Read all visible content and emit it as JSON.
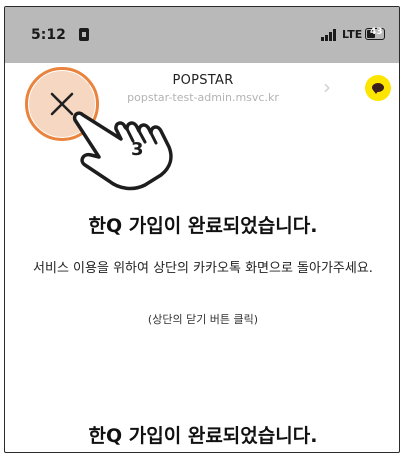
{
  "status_bar": {
    "time": "5:12",
    "network": "LTE",
    "battery": "43",
    "battery_fraction": 0.43
  },
  "browser": {
    "title": "POPSTAR",
    "url": "popstar-test-admin.msvc.kr"
  },
  "page": {
    "heading": "한Q 가입이 완료되었습니다.",
    "description": "서비스 이용을 위하여 상단의 카카오톡 화면으로 돌아가주세요.",
    "note": "(상단의 닫기 버튼 클릭)",
    "heading_repeat": "한Q 가입이 완료되었습니다."
  },
  "annotation": {
    "step": "3",
    "highlight_color": "#e9833d"
  },
  "icons": {
    "close": "close-icon",
    "kakao": "kakao-talk-icon",
    "hand": "hand-pointer-icon"
  },
  "colors": {
    "kakao_yellow": "#fee500",
    "status_overlay": "#b9b9b9"
  }
}
